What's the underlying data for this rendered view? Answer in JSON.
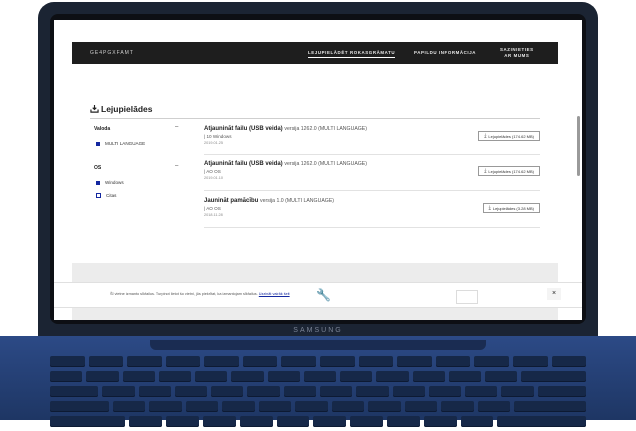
{
  "device": {
    "brand": "SAMSUNG"
  },
  "nav": {
    "logo": "GE4PGXFAMT",
    "items": [
      {
        "label": "LEJUPIELĀDĒT ROKASGRĀMATU"
      },
      {
        "label": "PAPILDU INFORMĀCIJA"
      },
      {
        "label_line1": "SAZINIETIES",
        "label_line2": "AR MUMS"
      }
    ]
  },
  "section": {
    "title": "Lejupielādes"
  },
  "filters": {
    "language": {
      "title": "Valoda",
      "toggle": "–",
      "options": [
        {
          "label": "MULTI LANGUAGE",
          "checked": true
        }
      ]
    },
    "os": {
      "title": "OS",
      "toggle": "–",
      "options": [
        {
          "label": "Windows",
          "checked": true
        },
        {
          "label": "Citas",
          "checked": true
        }
      ]
    }
  },
  "downloads": [
    {
      "name": "Atjaunināt failu (USB veida)",
      "version": "versija 1262.0 (MULTI LANGUAGE)",
      "os": "| 10 Windows",
      "date": "2019.01.25",
      "button": "Lejupielādes (174.62 MB)"
    },
    {
      "name": "Atjaunināt failu (USB veida)",
      "version": "versija 1262.0 (MULTI LANGUAGE)",
      "os": "| AO OS",
      "date": "2019.01.10",
      "button": "Lejupielādes (174.62 MB)"
    },
    {
      "name": "Jaunināt pamācību",
      "version": "versija 1.0 (MULTI LANGUAGE)",
      "os": "| AO OS",
      "date": "2018.11.28",
      "button": "Lejupielādes (3.28 MB)"
    }
  ],
  "cookie": {
    "text": "Šī vietne izmanto sīkfailus. Turpinot lietot šo vietni, jūs piekrītat, ka izmantojam sīkfailus.",
    "link": "Uzzināt vairāk šeit",
    "close": "×"
  },
  "colors": {
    "nav_bg": "#1e1e1e",
    "accent": "#1428a0",
    "laptop_body": "#2c4a86"
  }
}
